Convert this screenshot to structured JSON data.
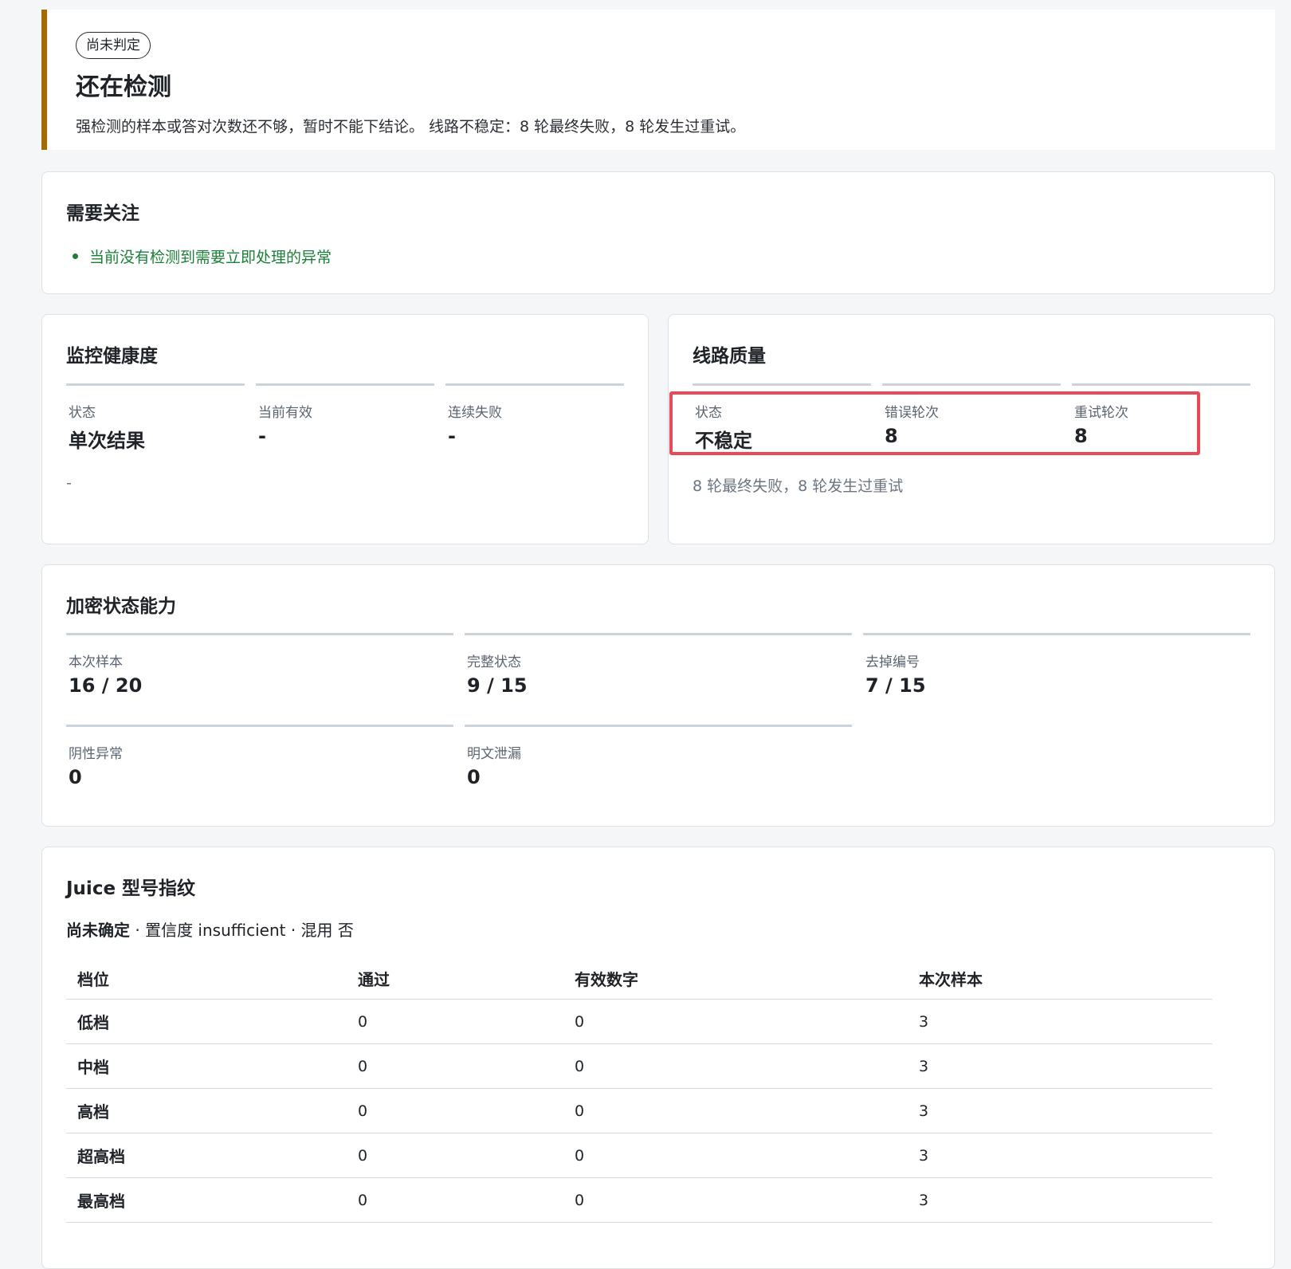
{
  "banner": {
    "badge": "尚未判定",
    "title": "还在检测",
    "description": "强检测的样本或答对次数还不够，暂时不能下结论。 线路不稳定：8 轮最终失败，8 轮发生过重试。"
  },
  "attention": {
    "title": "需要关注",
    "items": [
      "当前没有检测到需要立即处理的异常"
    ]
  },
  "monitor_health": {
    "title": "监控健康度",
    "metrics": [
      {
        "label": "状态",
        "value": "单次结果"
      },
      {
        "label": "当前有效",
        "value": "-"
      },
      {
        "label": "连续失败",
        "value": "-"
      }
    ],
    "note": "-"
  },
  "line_quality": {
    "title": "线路质量",
    "metrics": [
      {
        "label": "状态",
        "value": "不稳定"
      },
      {
        "label": "错误轮次",
        "value": "8"
      },
      {
        "label": "重试轮次",
        "value": "8"
      }
    ],
    "note": "8 轮最终失败，8 轮发生过重试"
  },
  "encryption": {
    "title": "加密状态能力",
    "metrics": [
      {
        "label": "本次样本",
        "value": "16 / 20"
      },
      {
        "label": "完整状态",
        "value": "9 / 15"
      },
      {
        "label": "去掉编号",
        "value": "7 / 15"
      },
      {
        "label": "阴性异常",
        "value": "0"
      },
      {
        "label": "明文泄漏",
        "value": "0"
      }
    ]
  },
  "fingerprint": {
    "title": "Juice 型号指纹",
    "summary_status": "尚未确定",
    "summary_rest": " · 置信度 insufficient · 混用 否",
    "columns": [
      "档位",
      "通过",
      "有效数字",
      "本次样本"
    ],
    "rows": [
      {
        "tier": "低档",
        "pass": "0",
        "valid": "0",
        "samples": "3"
      },
      {
        "tier": "中档",
        "pass": "0",
        "valid": "0",
        "samples": "3"
      },
      {
        "tier": "高档",
        "pass": "0",
        "valid": "0",
        "samples": "3"
      },
      {
        "tier": "超高档",
        "pass": "0",
        "valid": "0",
        "samples": "3"
      },
      {
        "tier": "最高档",
        "pass": "0",
        "valid": "0",
        "samples": "3"
      }
    ]
  },
  "colors": {
    "banner_accent": "#a56a00",
    "ok_green": "#1a7f37",
    "highlight_red": "#e84a57"
  }
}
